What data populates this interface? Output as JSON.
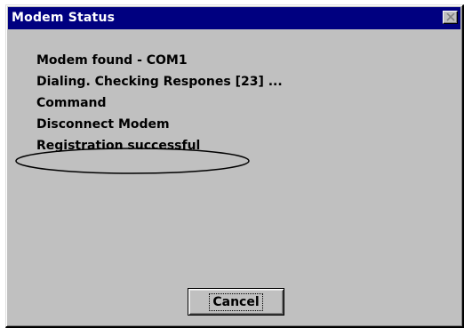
{
  "window": {
    "title": "Modem Status",
    "title_bar_color": "#000080",
    "background_color": "#c0c0c0",
    "close_icon": "close-x-icon"
  },
  "status": {
    "lines": [
      "Modem found - COM1",
      "Dialing. Checking Respones [23] ...",
      "Command",
      "Disconnect Modem",
      "Registration successful"
    ],
    "highlighted_line": "Registration successful"
  },
  "buttons": {
    "cancel_label": "Cancel"
  }
}
